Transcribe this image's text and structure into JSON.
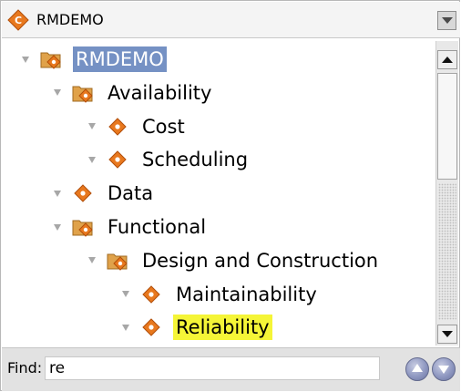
{
  "project_selector": {
    "value": "RMDEMO",
    "icon": "project-diamond-icon"
  },
  "tree": {
    "items": [
      {
        "label": "RMDEMO",
        "level": 0,
        "icon": "folder-diamond-icon",
        "state": "selected"
      },
      {
        "label": "Availability",
        "level": 1,
        "icon": "folder-diamond-icon",
        "state": "normal"
      },
      {
        "label": "Cost",
        "level": 2,
        "icon": "diamond-icon",
        "state": "normal"
      },
      {
        "label": "Scheduling",
        "level": 2,
        "icon": "diamond-icon",
        "state": "normal"
      },
      {
        "label": "Data",
        "level": 1,
        "icon": "diamond-icon",
        "state": "normal"
      },
      {
        "label": "Functional",
        "level": 1,
        "icon": "folder-diamond-icon",
        "state": "normal"
      },
      {
        "label": "Design and Construction",
        "level": 2,
        "icon": "folder-diamond-icon",
        "state": "normal"
      },
      {
        "label": "Maintainability",
        "level": 3,
        "icon": "diamond-icon",
        "state": "normal"
      },
      {
        "label": "Reliability",
        "level": 3,
        "icon": "diamond-icon",
        "state": "highlighted"
      }
    ]
  },
  "find": {
    "label": "Find:",
    "value": "re"
  },
  "colors": {
    "selection": "#7591c4",
    "match_highlight": "#f5f537",
    "icon_orange": "#e8781e"
  }
}
